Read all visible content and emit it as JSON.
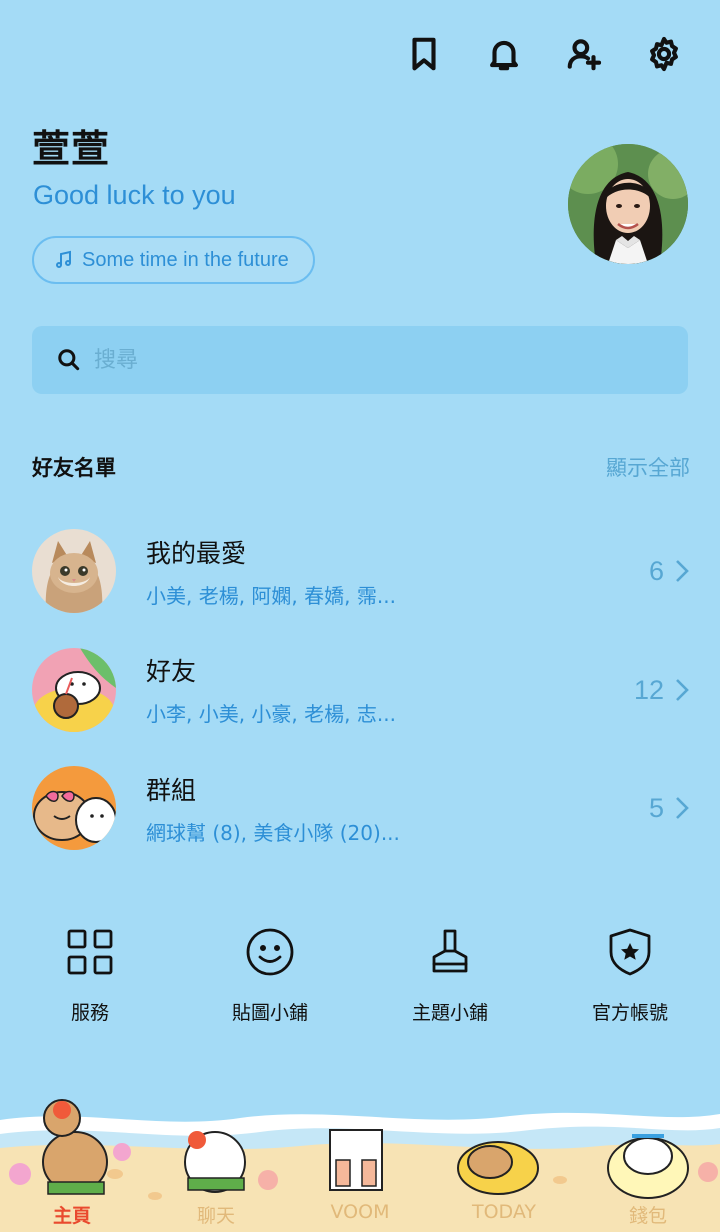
{
  "header": {
    "icons": [
      "bookmark-icon",
      "bell-icon",
      "add-friend-icon",
      "gear-icon"
    ]
  },
  "profile": {
    "name": "萱萱",
    "status_message": "Good luck to you",
    "music": "Some time in the future"
  },
  "search": {
    "placeholder": "搜尋"
  },
  "friends": {
    "title": "好友名單",
    "show_all": "顯示全部",
    "groups": [
      {
        "title": "我的最愛",
        "members": "小美, 老楊, 阿嫻, 春嬌, 霈...",
        "count": "6"
      },
      {
        "title": "好友",
        "members": "小李, 小美, 小豪, 老楊, 志...",
        "count": "12"
      },
      {
        "title": "群組",
        "members": "網球幫 (8), 美食小隊 (20)...",
        "count": "5"
      }
    ]
  },
  "services": [
    {
      "label": "服務",
      "icon": "grid-icon"
    },
    {
      "label": "貼圖小鋪",
      "icon": "smiley-icon"
    },
    {
      "label": "主題小鋪",
      "icon": "brush-icon"
    },
    {
      "label": "官方帳號",
      "icon": "shield-star-icon"
    }
  ],
  "nav": {
    "tabs": [
      "主頁",
      "聊天",
      "VOOM",
      "TODAY",
      "錢包"
    ],
    "active": "主頁"
  },
  "colors": {
    "background": "#a4dbf6",
    "accent": "#2d8fd6",
    "nav_active": "#e94a2e",
    "nav_inactive": "#e1b97a"
  }
}
